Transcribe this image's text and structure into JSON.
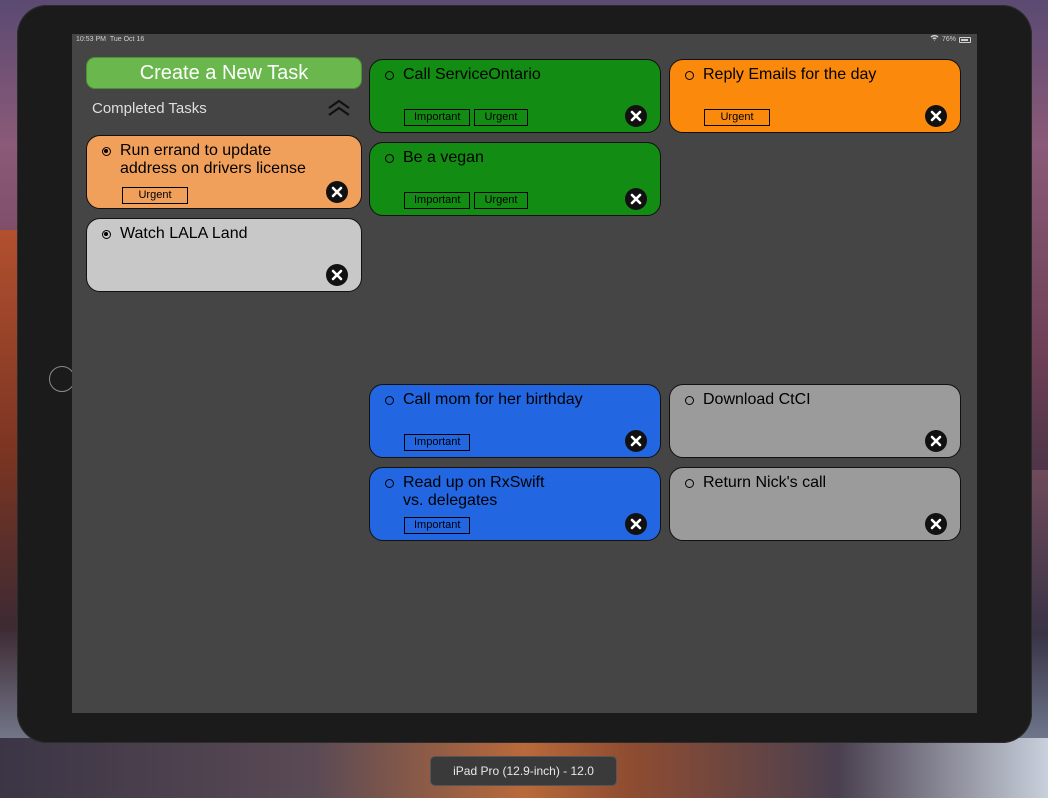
{
  "status_bar": {
    "time": "10:53 PM",
    "date": "Tue Oct 16",
    "battery": "76%"
  },
  "actions": {
    "create_label": "Create a New Task"
  },
  "completed": {
    "label": "Completed Tasks",
    "tasks": [
      {
        "title": "Run errand to update address on drivers license",
        "tags": [
          "Urgent"
        ],
        "color": "#f1a05c",
        "done": true
      },
      {
        "title": "Watch LALA Land",
        "tags": [],
        "color": "#c8c8c8",
        "done": true
      }
    ]
  },
  "tasks": [
    {
      "title": "Call ServiceOntario",
      "tags": [
        "Important",
        "Urgent"
      ],
      "color": "#128c12"
    },
    {
      "title": "Reply Emails for the day",
      "tags": [
        "Urgent"
      ],
      "color": "#fb8a0c"
    },
    {
      "title": "Be a vegan",
      "tags": [
        "Important",
        "Urgent"
      ],
      "color": "#128c12"
    },
    {
      "title": "Call mom for her birthday",
      "tags": [
        "Important"
      ],
      "color": "#2266e2"
    },
    {
      "title": "Download CtCI",
      "tags": [],
      "color": "#9b9b9b"
    },
    {
      "title": "Read up on RxSwift vs. delegates",
      "tags": [
        "Important"
      ],
      "color": "#2266e2"
    },
    {
      "title": "Return Nick's call",
      "tags": [],
      "color": "#9b9b9b"
    }
  ],
  "simulator": {
    "device_label": "iPad Pro (12.9-inch) - 12.0"
  },
  "icons": {
    "collapse": "chevron-double-up-icon",
    "delete": "close-circle-icon"
  }
}
